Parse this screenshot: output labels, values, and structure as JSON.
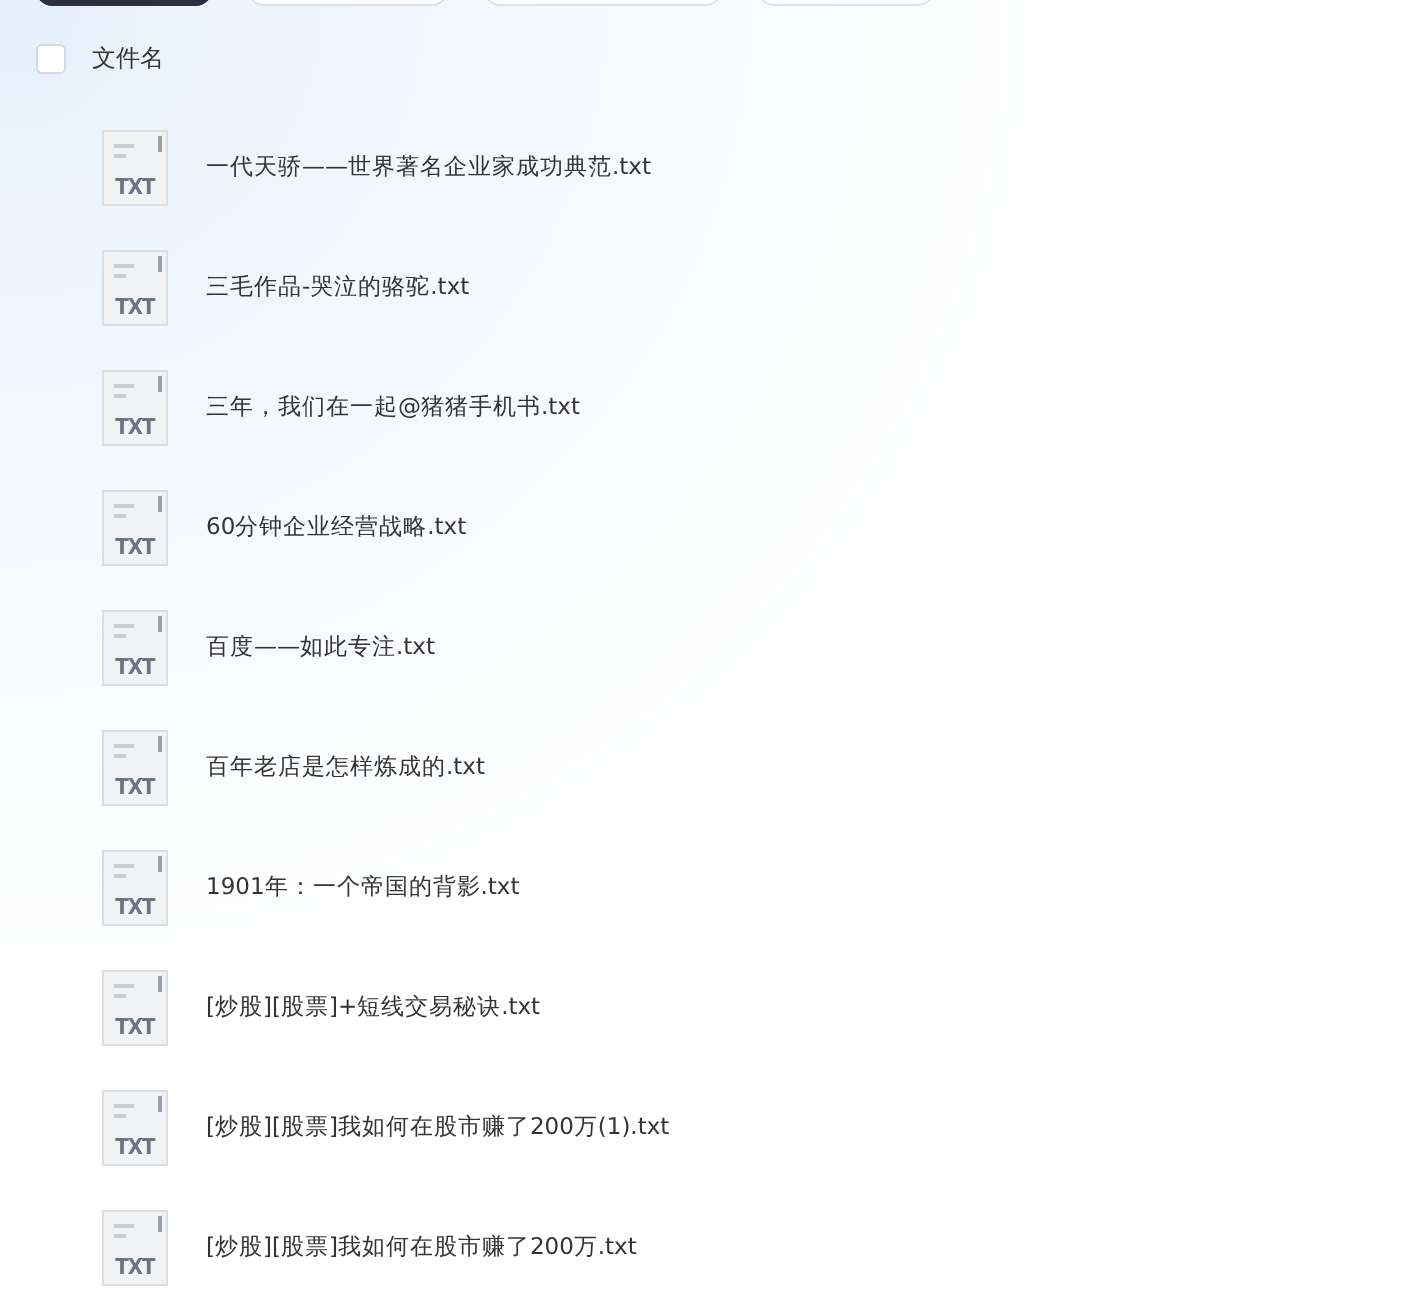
{
  "toolbar_buttons": [
    {
      "selected": true
    },
    {
      "selected": false
    },
    {
      "selected": false
    },
    {
      "selected": false
    }
  ],
  "header": {
    "checked": false,
    "label": "文件名"
  },
  "files": [
    {
      "name": "一代天骄——世界著名企业家成功典范.txt",
      "icon_label": "TXT"
    },
    {
      "name": "三毛作品-哭泣的骆驼.txt",
      "icon_label": "TXT"
    },
    {
      "name": "三年，我们在一起@猪猪手机书.txt",
      "icon_label": "TXT"
    },
    {
      "name": "60分钟企业经营战略.txt",
      "icon_label": "TXT"
    },
    {
      "name": "百度——如此专注.txt",
      "icon_label": "TXT"
    },
    {
      "name": "百年老店是怎样炼成的.txt",
      "icon_label": "TXT"
    },
    {
      "name": "1901年：一个帝国的背影.txt",
      "icon_label": "TXT"
    },
    {
      "name": "[炒股][股票]+短线交易秘诀.txt",
      "icon_label": "TXT"
    },
    {
      "name": "[炒股][股票]我如何在股市赚了200万(1).txt",
      "icon_label": "TXT"
    },
    {
      "name": "[炒股][股票]我如何在股市赚了200万.txt",
      "icon_label": "TXT"
    }
  ]
}
